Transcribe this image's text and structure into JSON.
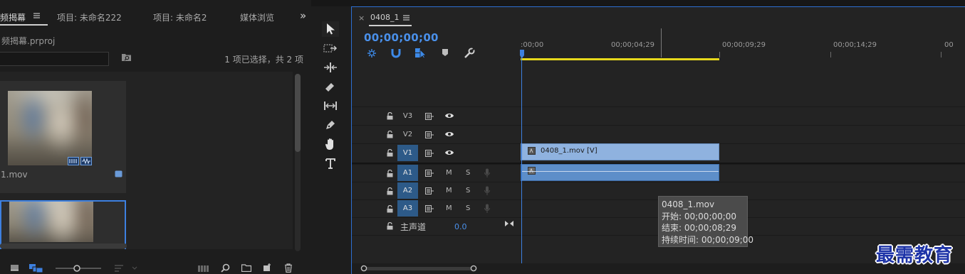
{
  "project_panel": {
    "tabs": [
      {
        "label": "频揭幕",
        "active": true
      },
      {
        "label": "项目: 未命名222",
        "active": false
      },
      {
        "label": "项目: 未命名2",
        "active": false
      },
      {
        "label": "媒体浏览",
        "active": false
      }
    ],
    "overflow_glyph": "»",
    "project_file": "频揭幕.prproj",
    "search": {
      "value": "",
      "placeholder": ""
    },
    "selection_status": "1 项已选择，共 2 项",
    "items": [
      {
        "filename": "1.mov",
        "selected": false
      },
      {
        "filename": "",
        "selected": true
      }
    ],
    "bottom_toolbar_icons": [
      "list-view-icon",
      "icon-view-icon",
      "zoom-slider",
      "sort-icon",
      "automate-to-sequence-icon",
      "find-icon",
      "new-bin-icon",
      "new-item-icon",
      "delete-icon"
    ]
  },
  "tools": [
    "selection-tool",
    "track-select-forward-tool",
    "ripple-edit-tool",
    "razor-tool",
    "slip-tool",
    "pen-tool",
    "hand-tool",
    "type-tool"
  ],
  "timeline": {
    "sequence_name": "0408_1",
    "close_glyph": "×",
    "timecode": "00;00;00;00",
    "ruler_labels": [
      ":00;00",
      "00;00;04;29",
      "00;00;09;29",
      "00;00;14;29",
      "00"
    ],
    "video_tracks": [
      {
        "name": "V3",
        "target": false
      },
      {
        "name": "V2",
        "target": false
      },
      {
        "name": "V1",
        "target": true
      }
    ],
    "audio_tracks": [
      {
        "name": "A1",
        "mute": "M",
        "solo": "S"
      },
      {
        "name": "A2",
        "mute": "M",
        "solo": "S"
      },
      {
        "name": "A3",
        "mute": "M",
        "solo": "S"
      }
    ],
    "master": {
      "label": "主声道",
      "value": "0.0"
    },
    "clips": {
      "v1_clip_name": "0408_1.mov [V]",
      "a1_clip_name": ""
    },
    "tooltip": {
      "title": "0408_1.mov",
      "start": "开始: 00;00;00;00",
      "end": "结束: 00;00;08;29",
      "duration": "持续时间: 00;00;09;00"
    },
    "colors": {
      "accent": "#4a90ea",
      "work_area": "#e6d81c",
      "video_clip": "#8fb2df",
      "audio_clip": "#5d8ec9",
      "target_track": "#2d5a88"
    }
  },
  "watermark": "最需教育"
}
